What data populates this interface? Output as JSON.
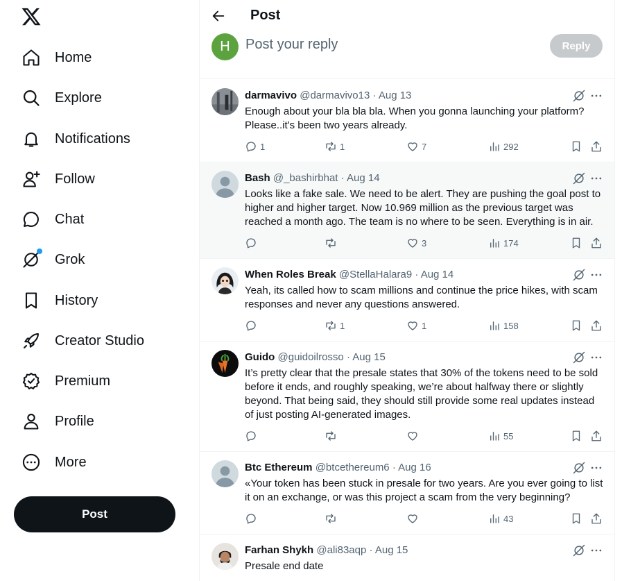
{
  "nav": {
    "home": "Home",
    "explore": "Explore",
    "notifications": "Notifications",
    "follow": "Follow",
    "chat": "Chat",
    "grok": "Grok",
    "history": "History",
    "creator_studio": "Creator Studio",
    "premium": "Premium",
    "profile": "Profile",
    "more": "More",
    "post_button": "Post"
  },
  "header": {
    "title": "Post"
  },
  "composer": {
    "avatar_letter": "H",
    "placeholder": "Post your reply",
    "reply_button": "Reply"
  },
  "tweets": [
    {
      "name": "darmavivo",
      "handle": "@darmavivo13",
      "date": "Aug 13",
      "text": "Enough about your bla bla bla. When you gonna launching your platform? Please..it's been two years already.",
      "replies": "1",
      "reposts": "1",
      "likes": "7",
      "views": "292"
    },
    {
      "name": "Bash",
      "handle": "@_bashirbhat",
      "date": "Aug 14",
      "text": "Looks like a fake sale. We need to be alert. They are pushing the goal post to higher and higher target. Now 10.969 million as the previous target was reached a month ago. The team is no where to be seen. Everything is in air.",
      "replies": "",
      "reposts": "",
      "likes": "3",
      "views": "174"
    },
    {
      "name": "When Roles Break",
      "handle": "@StellaHalara9",
      "date": "Aug 14",
      "text": "Yeah, its called how to scam millions and continue the price hikes, with scam responses and never any questions answered.",
      "replies": "",
      "reposts": "1",
      "likes": "1",
      "views": "158"
    },
    {
      "name": "Guido",
      "handle": "@guidoilrosso",
      "date": "Aug 15",
      "text": "It’s pretty clear that the presale states that 30% of the tokens need to be sold before it ends, and roughly speaking, we’re about halfway there or slightly beyond. That being said, they should still provide some real updates instead of just posting AI-generated images.",
      "replies": "",
      "reposts": "",
      "likes": "",
      "views": "55"
    },
    {
      "name": "Btc Ethereum",
      "handle": "@btcethereum6",
      "date": "Aug 16",
      "text": "«Your token has been stuck in presale for two years. Are you ever going to list it on an exchange, or was this project a scam from the very beginning?",
      "replies": "",
      "reposts": "",
      "likes": "",
      "views": "43"
    },
    {
      "name": "Farhan Shykh",
      "handle": "@ali83aqp",
      "date": "Aug 15",
      "text": "Presale end date",
      "replies": "",
      "reposts": "",
      "likes": "",
      "views": ""
    }
  ]
}
